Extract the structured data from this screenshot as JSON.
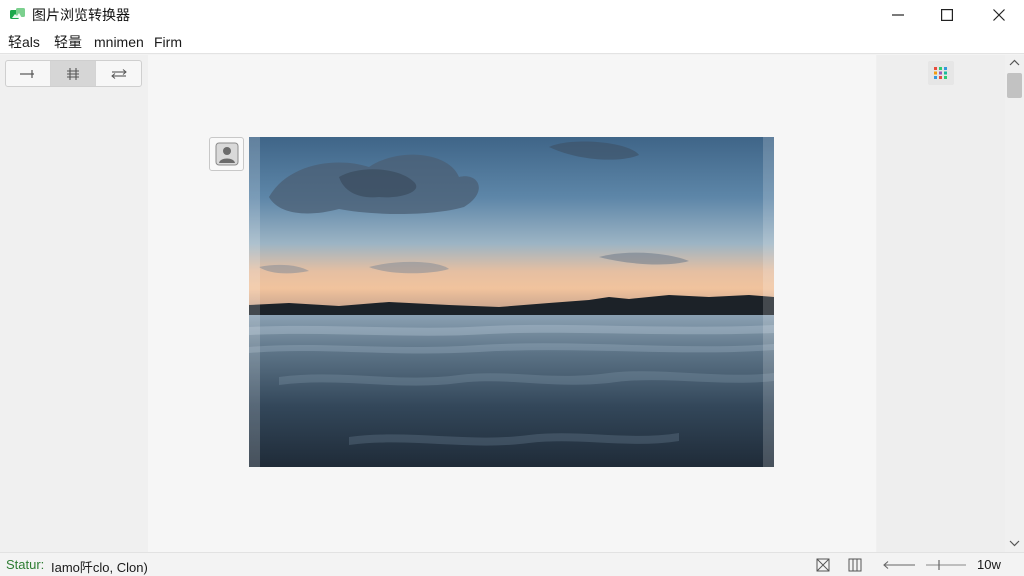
{
  "window": {
    "title": "图片浏览转换器"
  },
  "menu": {
    "items": [
      "轻als",
      "轻量",
      "mnimen",
      "Firm"
    ]
  },
  "toolbar": {
    "buttons": [
      {
        "icon": "arrow-right-icon",
        "active": false
      },
      {
        "icon": "columns-icon",
        "active": true
      },
      {
        "icon": "transfer-icon",
        "active": false
      }
    ]
  },
  "view": {
    "grid_icon": "grid-icon",
    "profile_icon": "person-icon"
  },
  "status": {
    "label": "Statur:",
    "text": "Iamo阡clo, Clon)",
    "zoom": "10w"
  },
  "colors": {
    "status_label": "#2e7d32",
    "accent": "#1ba84a"
  }
}
